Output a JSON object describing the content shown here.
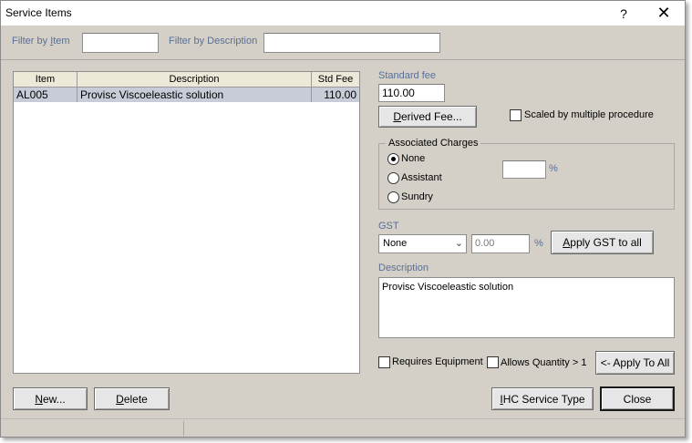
{
  "window": {
    "title": "Service Items",
    "help_label": "?",
    "close_label": "✕"
  },
  "filter": {
    "item_label": "Filter by Item",
    "item_value": "",
    "desc_label": "Filter by Description",
    "desc_value": ""
  },
  "grid": {
    "columns": [
      "Item",
      "Description",
      "Std Fee"
    ],
    "rows": [
      {
        "item": "AL005",
        "description": "Provisc Viscoeleastic solution",
        "std_fee": "110.00"
      }
    ]
  },
  "detail": {
    "standard_fee_label": "Standard fee",
    "standard_fee_value": "110.00",
    "derived_fee_button": "Derived Fee...",
    "scaled_label": "Scaled by multiple procedure",
    "associated_charges": {
      "title": "Associated Charges",
      "options": [
        "None",
        "Assistant",
        "Sundry"
      ],
      "selected": "None",
      "percent_value": "",
      "percent_sign": "%"
    },
    "gst": {
      "label": "GST",
      "select_value": "None",
      "rate_value": "0.00",
      "percent_sign": "%",
      "apply_button": "Apply GST to all"
    },
    "description_label": "Description",
    "description_value": "Provisc Viscoeleastic solution",
    "requires_equipment_label": "Requires Equipment",
    "allows_quantity_label": "Allows Quantity > 1",
    "apply_to_all_button": "<- Apply To All"
  },
  "footer": {
    "new_button": "New...",
    "delete_button": "Delete",
    "ihc_button": "IHC Service Type",
    "close_button": "Close"
  }
}
